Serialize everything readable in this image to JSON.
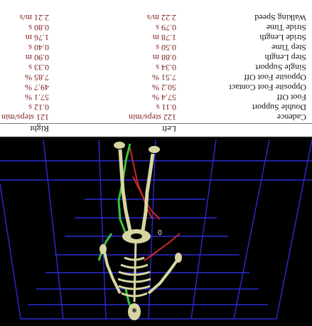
{
  "table": {
    "headers": {
      "label": "",
      "left": "Left",
      "right": "Right"
    },
    "rows": [
      {
        "label": "Cadence",
        "left": "122 steps/min",
        "right": "121 steps/min"
      },
      {
        "label": "Double Support",
        "left": "0.11 s",
        "right": "0.12 s"
      },
      {
        "label": "Foot Off",
        "left": "57.4 %",
        "right": "57.1 %"
      },
      {
        "label": "Opposite Foot Contact",
        "left": "50.2 %",
        "right": "49.7 %"
      },
      {
        "label": "Opposite Foot Off",
        "left": "7.51 %",
        "right": "7.85 %"
      },
      {
        "label": "Single Support",
        "left": "0.34 s",
        "right": "0.33 s"
      },
      {
        "label": "Step Length",
        "left": "0.88 m",
        "right": "0.90 m"
      },
      {
        "label": "Step Time",
        "left": "0.50 s",
        "right": "0.40 s"
      },
      {
        "label": "Stride Length",
        "left": "1.78 m",
        "right": "1.76 m"
      },
      {
        "label": "Stride Time",
        "left": "0.79 s",
        "right": "0.80 s"
      },
      {
        "label": "Walking Speed",
        "left": "2.22 m/s",
        "right": "2.21 m/s"
      }
    ]
  },
  "viewport": {
    "marker": "0",
    "colors": {
      "background": "#000000",
      "grid": "#2b2bd6",
      "bone": "#d8d6a0",
      "left_segment": "#3cc43c",
      "right_segment": "#c62828"
    }
  }
}
